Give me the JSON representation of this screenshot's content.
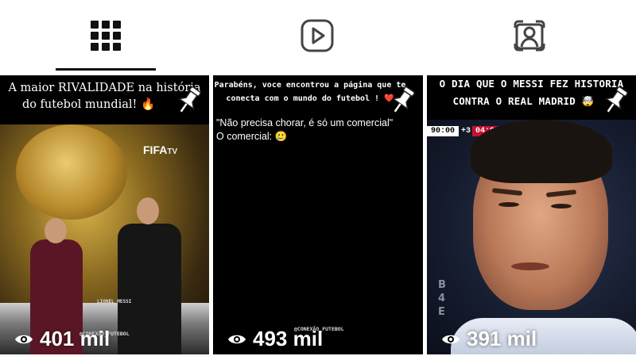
{
  "tabs": [
    {
      "icon": "grid-icon",
      "selected": true
    },
    {
      "icon": "reels-play-icon",
      "selected": false
    },
    {
      "icon": "tagged-person-icon",
      "selected": false
    }
  ],
  "reels": [
    {
      "caption_line1": "A maior RIVALIDADE na história",
      "caption_line2": "do futebol mundial! 🔥",
      "logo_text": "FIFA",
      "logo_sub": "TV",
      "stage_label": "LIONEL MESSI",
      "watermark": "@CONEXÃO_FUTEBOL",
      "views": "401 mil",
      "pinned": true
    },
    {
      "caption_line1": "Parabéns, voce encontrou a página que te",
      "caption_line2": "conecta com o mundo do futebol ! ❤️",
      "body_line1": "\"Não precisa chorar, é só um comercial\"",
      "body_line2": "O comercial: 🥲",
      "watermark": "@CONEXÃO_FUTEBOL",
      "views": "493 mil",
      "pinned": true
    },
    {
      "caption_line1": "O DIA QUE O MESSI FEZ HISTORIA",
      "caption_line2": "CONTRA O REAL MADRID 🤯",
      "score_time": "90:00",
      "score_add": "+3",
      "score_clock": "04:08",
      "side_letters": "B\n4\nE",
      "views": "391 mil",
      "pinned": true
    }
  ],
  "colors": {
    "tab_underline": "#111111",
    "background": "#ffffff",
    "tile_background": "#000000"
  }
}
